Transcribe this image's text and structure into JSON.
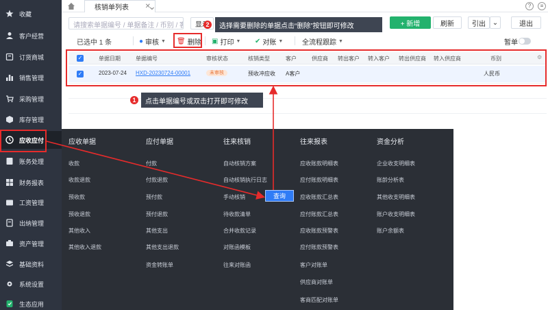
{
  "sidebar": {
    "items": [
      {
        "label": "收藏",
        "icon": "star-icon"
      },
      {
        "label": "客户经营",
        "icon": "person-icon"
      },
      {
        "label": "订货商城",
        "icon": "shop-icon"
      },
      {
        "label": "销售管理",
        "icon": "bar-icon"
      },
      {
        "label": "采购管理",
        "icon": "cart-icon"
      },
      {
        "label": "库存管理",
        "icon": "box-icon"
      },
      {
        "label": "应收应付",
        "icon": "clock-icon"
      },
      {
        "label": "账务处理",
        "icon": "ledger-icon"
      },
      {
        "label": "财务报表",
        "icon": "report-icon"
      },
      {
        "label": "工资管理",
        "icon": "wallet-icon"
      },
      {
        "label": "出纳管理",
        "icon": "cashier-icon"
      },
      {
        "label": "资产管理",
        "icon": "asset-icon"
      },
      {
        "label": "基础资料",
        "icon": "layers-icon"
      },
      {
        "label": "系统设置",
        "icon": "gear-icon"
      },
      {
        "label": "生态应用",
        "icon": "app-icon"
      }
    ]
  },
  "tabs": {
    "active": "核销单列表",
    "add_label": "+"
  },
  "search": {
    "placeholder": "请搜索单据编号 / 单据备注 / 币别 / 客..."
  },
  "toolbar": {
    "new_label": "+ 新增",
    "refresh_label": "刷新",
    "export_label": "引出",
    "exit_label": "退出",
    "show_label": "显示"
  },
  "tip2": {
    "num": "2",
    "text": "选择需要删除的单据点击“删除”按钮即可修改"
  },
  "actions": {
    "selected": "已选中 1 条",
    "audit": "审核",
    "delete": "删除",
    "print": "打印",
    "reconcile": "对账",
    "trace": "全流程跟踪",
    "pin": "暂单"
  },
  "table": {
    "headers": [
      "单据日期",
      "单据编号",
      "审核状态",
      "核销类型",
      "客户",
      "供应商",
      "转出客户",
      "转入客户",
      "转出供应商",
      "转入供应商",
      "币别"
    ],
    "row": {
      "date": "2023-07-24",
      "code": "HXD-20230724-00001",
      "status": "未审核",
      "type": "预收冲应收",
      "customer": "A客户",
      "currency": "人民币"
    }
  },
  "tip1": {
    "num": "1",
    "text": "点击单据编号或双击打开即可修改"
  },
  "mega_menu": {
    "columns": [
      {
        "title": "应收单据",
        "items": [
          "收款",
          "收款退款",
          "预收款",
          "预收退款",
          "其他收入",
          "其他收入退款"
        ]
      },
      {
        "title": "应付单据",
        "items": [
          "付款",
          "付款退款",
          "预付款",
          "预付退款",
          "其他支出",
          "其他支出退款",
          "资金转账单"
        ]
      },
      {
        "title": "往来核销",
        "items": [
          "自动核销方案",
          "自动核销执行日志",
          "手动核销",
          "待收款清单",
          "合并收款记录",
          "对账函模板",
          "往来对账函"
        ]
      },
      {
        "title": "往来报表",
        "items": [
          "应收账款明细表",
          "应付账款明细表",
          "应收账款汇总表",
          "应付账款汇总表",
          "应收账款预警表",
          "应付账款预警表",
          "客户对账单",
          "供应商对账单",
          "客商匹配对账单"
        ]
      },
      {
        "title": "资金分析",
        "items": [
          "企业收支明细表",
          "账龄分析表",
          "其他收支明细表",
          "账户收支明细表",
          "账户余额表"
        ]
      }
    ],
    "query_label": "查询"
  }
}
